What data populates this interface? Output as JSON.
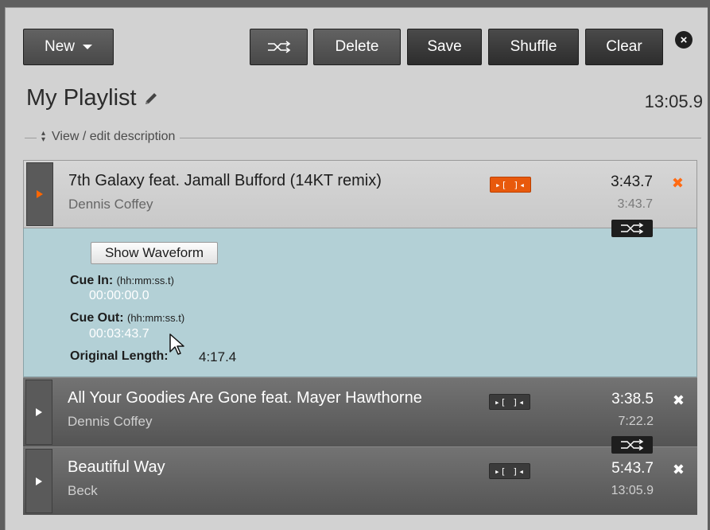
{
  "toolbar": {
    "new_label": "New",
    "delete_label": "Delete",
    "save_label": "Save",
    "shuffle_label": "Shuffle",
    "clear_label": "Clear",
    "close_glyph": "×"
  },
  "playlist": {
    "title": "My Playlist",
    "total_length": "13:05.9",
    "description_toggle": "View / edit description"
  },
  "tracks": [
    {
      "title": "7th Galaxy feat. Jamall Bufford (14KT remix)",
      "artist": "Dennis Coffey",
      "cue_badge": "▸[ ]◂",
      "length": "3:43.7",
      "cumulative": "3:43.7",
      "remove": "✖",
      "state": "expanded",
      "details": {
        "waveform_button": "Show Waveform",
        "cue_in_label": "Cue In:",
        "cue_in_format": "(hh:mm:ss.t)",
        "cue_in_value": "00:00:00.0",
        "cue_out_label": "Cue Out:",
        "cue_out_format": "(hh:mm:ss.t)",
        "cue_out_value": "00:03:43.7",
        "original_length_label": "Original Length:",
        "original_length_value": "4:17.4"
      }
    },
    {
      "title": "All Your Goodies Are Gone feat. Mayer Hawthorne",
      "artist": "Dennis Coffey",
      "cue_badge": "▸[ ]◂",
      "length": "3:38.5",
      "cumulative": "7:22.2",
      "remove": "✖"
    },
    {
      "title": "Beautiful Way",
      "artist": "Beck",
      "cue_badge": "▸[ ]◂",
      "length": "5:43.7",
      "cumulative": "13:05.9",
      "remove": "✖"
    }
  ],
  "colors": {
    "accent_orange": "#ff6600",
    "details_bg": "#b3d0d6",
    "toolbar_button": "#2d2d2d"
  },
  "icons": [
    "caret-down-icon",
    "shuffle-icon",
    "close-circle-icon",
    "pencil-icon",
    "sort-arrows-icon",
    "play-icon",
    "cue-icon",
    "remove-icon",
    "crossfade-icon",
    "mouse-cursor-icon"
  ]
}
